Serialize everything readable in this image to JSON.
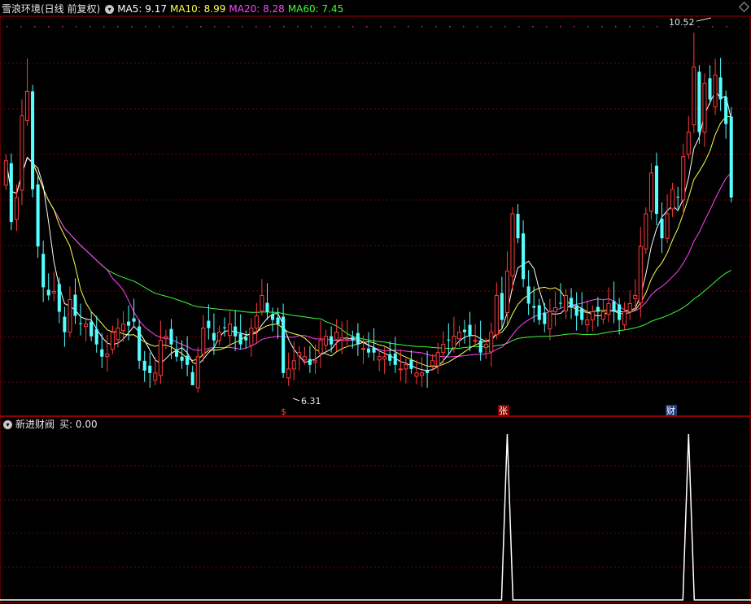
{
  "header": {
    "title": "雪浪环境(日线 前复权)",
    "ma5": "MA5: 9.17",
    "ma10": "MA10: 8.99",
    "ma20": "MA20: 8.28",
    "ma60": "MA60: 7.45"
  },
  "indicator_header": {
    "title": "新进财阀",
    "buy": "买: 0.00"
  },
  "markers": {
    "high_label": "10.52",
    "low_label": "6.31",
    "marker_s": "$",
    "marker_zhang": "张",
    "marker_cai": "财"
  },
  "colors": {
    "up": "#ff3b3b",
    "down": "#54ffff",
    "ma5": "#ffffff",
    "ma10": "#ffff4f",
    "ma20": "#ff45ff",
    "ma60": "#3cff3c",
    "grid": "#7a0000"
  },
  "chart_data": {
    "type": "candlestick",
    "title": "雪浪环境(日线 前复权)",
    "y_range": [
      6.0,
      10.7
    ],
    "series_ma": {
      "MA5": 9.17,
      "MA10": 8.99,
      "MA20": 8.28,
      "MA60": 7.45
    },
    "highlights": {
      "high": 10.52,
      "low": 6.31
    },
    "closes": [
      8.95,
      8.2,
      8.5,
      9.5,
      9.8,
      8.6,
      7.9,
      7.4,
      7.3,
      7.35,
      7.1,
      6.85,
      7.25,
      7.05,
      6.95,
      6.95,
      6.8,
      6.7,
      6.55,
      6.58,
      6.85,
      6.9,
      6.95,
      6.93,
      6.98,
      6.5,
      6.38,
      6.35,
      6.35,
      6.75,
      6.8,
      6.7,
      6.55,
      6.5,
      6.45,
      6.2,
      6.55,
      6.9,
      6.9,
      6.75,
      6.85,
      6.9,
      6.95,
      6.8,
      6.7,
      6.75,
      6.9,
      7.05,
      7.3,
      7.1,
      7.0,
      6.95,
      6.35,
      6.4,
      6.5,
      6.6,
      6.55,
      6.45,
      6.5,
      6.75,
      6.8,
      6.7,
      6.85,
      6.78,
      6.76,
      6.75,
      6.7,
      6.65,
      6.6,
      6.6,
      6.55,
      6.55,
      6.5,
      6.45,
      6.4,
      6.45,
      6.4,
      6.35,
      6.35,
      6.35,
      6.5,
      6.6,
      6.7,
      6.75,
      6.8,
      6.85,
      6.85,
      6.8,
      6.75,
      6.6,
      6.7,
      6.85,
      7.3,
      7.0,
      7.6,
      8.3,
      8.0,
      7.5,
      7.2,
      7.15,
      7.0,
      6.95,
      7.1,
      7.15,
      7.2,
      7.3,
      7.15,
      7.05,
      7.0,
      7.0,
      7.1,
      7.1,
      7.1,
      7.2,
      7.1,
      7.0,
      7.1,
      7.2,
      7.3,
      7.9,
      8.3,
      8.8,
      8.3,
      8.0,
      8.3,
      8.6,
      8.5,
      9.0,
      9.3,
      10.1,
      9.3,
      9.9,
      9.7,
      10.0,
      9.7,
      9.4,
      8.5
    ]
  },
  "indicator_data": {
    "type": "line",
    "name": "买",
    "spikes_at_index": [
      94,
      128
    ],
    "base": 0,
    "peak": 1
  }
}
